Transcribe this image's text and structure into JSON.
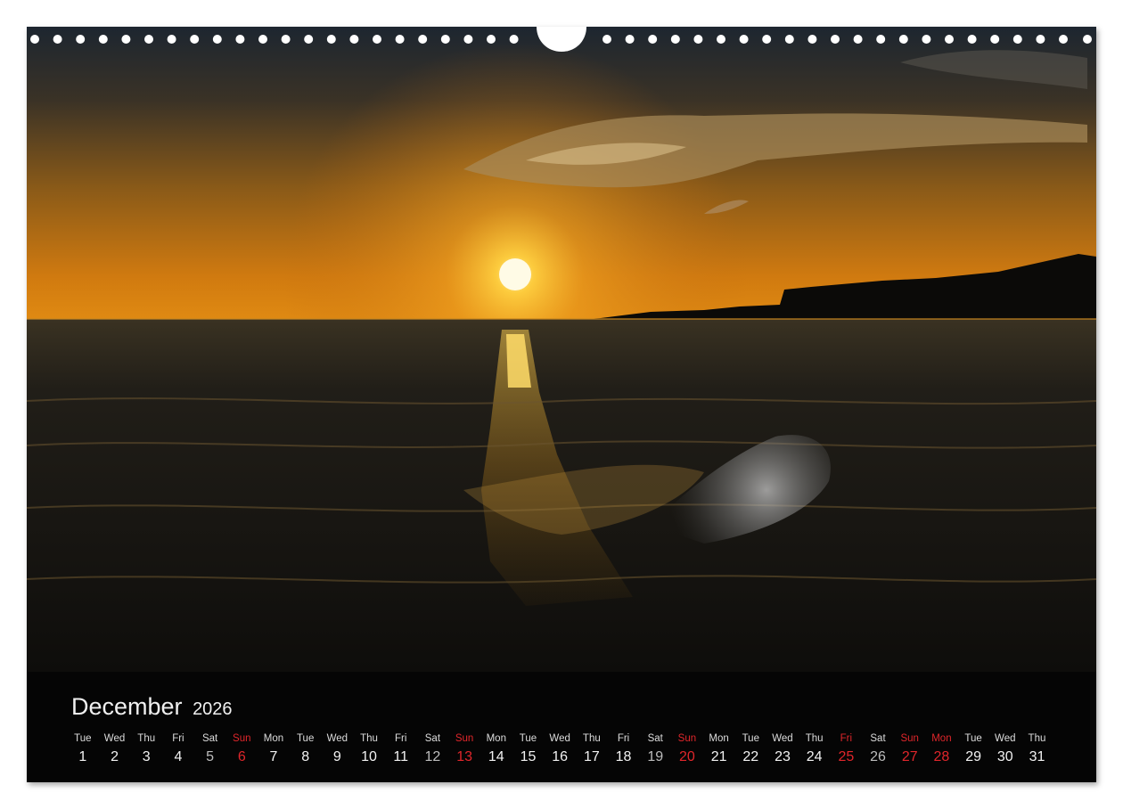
{
  "calendar": {
    "month": "December",
    "year": "2026",
    "days": [
      {
        "dow": "Tue",
        "num": "1",
        "holiday": false
      },
      {
        "dow": "Wed",
        "num": "2",
        "holiday": false
      },
      {
        "dow": "Thu",
        "num": "3",
        "holiday": false
      },
      {
        "dow": "Fri",
        "num": "4",
        "holiday": false
      },
      {
        "dow": "Sat",
        "num": "5",
        "holiday": false
      },
      {
        "dow": "Sun",
        "num": "6",
        "holiday": true
      },
      {
        "dow": "Mon",
        "num": "7",
        "holiday": false
      },
      {
        "dow": "Tue",
        "num": "8",
        "holiday": false
      },
      {
        "dow": "Wed",
        "num": "9",
        "holiday": false
      },
      {
        "dow": "Thu",
        "num": "10",
        "holiday": false
      },
      {
        "dow": "Fri",
        "num": "11",
        "holiday": false
      },
      {
        "dow": "Sat",
        "num": "12",
        "holiday": false
      },
      {
        "dow": "Sun",
        "num": "13",
        "holiday": true
      },
      {
        "dow": "Mon",
        "num": "14",
        "holiday": false
      },
      {
        "dow": "Tue",
        "num": "15",
        "holiday": false
      },
      {
        "dow": "Wed",
        "num": "16",
        "holiday": false
      },
      {
        "dow": "Thu",
        "num": "17",
        "holiday": false
      },
      {
        "dow": "Fri",
        "num": "18",
        "holiday": false
      },
      {
        "dow": "Sat",
        "num": "19",
        "holiday": false
      },
      {
        "dow": "Sun",
        "num": "20",
        "holiday": true
      },
      {
        "dow": "Mon",
        "num": "21",
        "holiday": false
      },
      {
        "dow": "Tue",
        "num": "22",
        "holiday": false
      },
      {
        "dow": "Wed",
        "num": "23",
        "holiday": false
      },
      {
        "dow": "Thu",
        "num": "24",
        "holiday": false
      },
      {
        "dow": "Fri",
        "num": "25",
        "holiday": true
      },
      {
        "dow": "Sat",
        "num": "26",
        "holiday": false
      },
      {
        "dow": "Sun",
        "num": "27",
        "holiday": true
      },
      {
        "dow": "Mon",
        "num": "28",
        "holiday": true
      },
      {
        "dow": "Tue",
        "num": "29",
        "holiday": false
      },
      {
        "dow": "Wed",
        "num": "30",
        "holiday": false
      },
      {
        "dow": "Thu",
        "num": "31",
        "holiday": false
      }
    ]
  },
  "colors": {
    "holiday": "#e0262b",
    "background": "#050505",
    "text": "#f2f2f2"
  }
}
